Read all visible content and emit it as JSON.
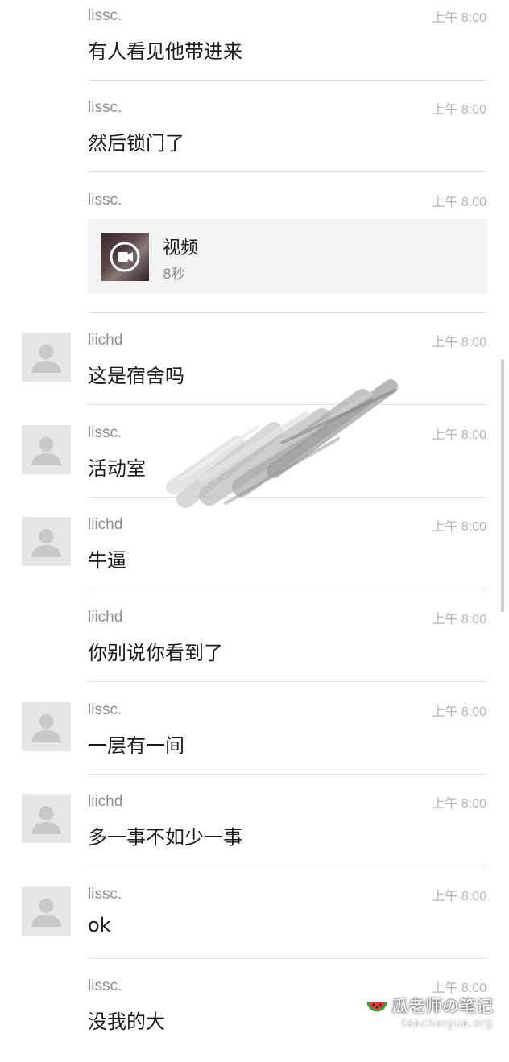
{
  "messages": [
    {
      "sender": "lissc.",
      "time": "上午 8:00",
      "text": "有人看见他带进来",
      "avatar": false
    },
    {
      "sender": "lissc.",
      "time": "上午 8:00",
      "text": "然后锁门了",
      "avatar": false
    },
    {
      "sender": "lissc.",
      "time": "上午 8:00",
      "type": "video",
      "video": {
        "title": "视频",
        "duration": "8秒"
      },
      "avatar": false
    },
    {
      "sender": "liichd",
      "time": "上午 8:00",
      "text": "这是宿舍吗",
      "avatar": true
    },
    {
      "sender": "lissc.",
      "time": "上午 8:00",
      "text": "活动室",
      "avatar": true
    },
    {
      "sender": "liichd",
      "time": "上午 8:00",
      "text": "牛逼",
      "avatar": true
    },
    {
      "sender": "liichd",
      "time": "上午 8:00",
      "text": "你别说你看到了",
      "avatar": false
    },
    {
      "sender": "lissc.",
      "time": "上午 8:00",
      "text": "一层有一间",
      "avatar": true
    },
    {
      "sender": "liichd",
      "time": "上午 8:00",
      "text": "多一事不如少一事",
      "avatar": true
    },
    {
      "sender": "lissc.",
      "time": "上午 8:00",
      "text": "ok",
      "avatar": true
    },
    {
      "sender": "lissc.",
      "time": "上午 8:00",
      "text": "没我的大",
      "avatar": false
    }
  ],
  "watermark": {
    "title": "瓜老师の笔记",
    "url": "teachergua.org"
  },
  "colors": {
    "text": "#1b1b1b",
    "sender": "#8e8e8e",
    "time": "#b4b4b4",
    "divider": "#e2e2e2",
    "avatar_bg": "#e6e6e6"
  }
}
